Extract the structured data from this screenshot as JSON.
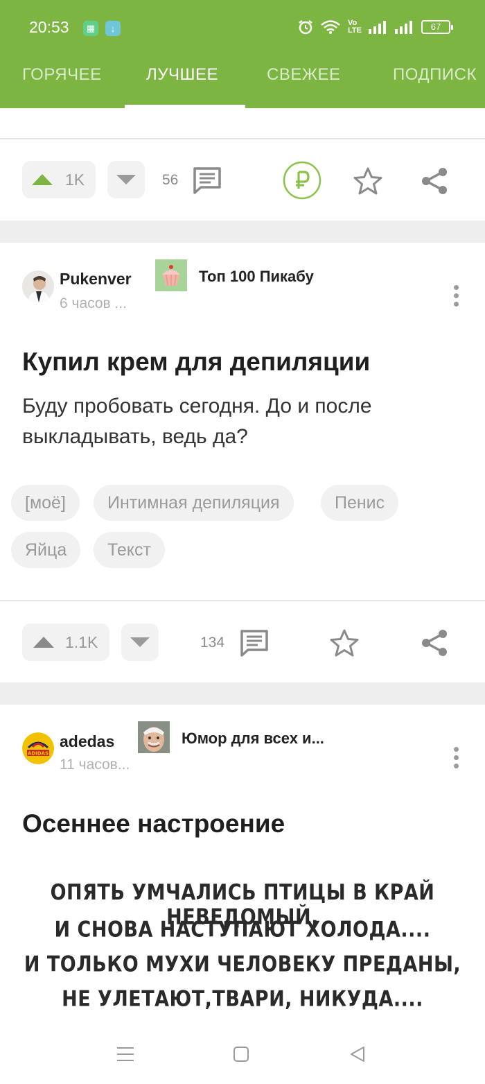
{
  "status_bar": {
    "time": "20:53",
    "battery": "67"
  },
  "tabs": [
    {
      "label": "ГОРЯЧЕЕ"
    },
    {
      "label": "ЛУЧШЕЕ"
    },
    {
      "label": "СВЕЖЕЕ"
    },
    {
      "label": "ПОДПИСК"
    }
  ],
  "prev_post": {
    "upvotes": "1K",
    "comments": "56"
  },
  "post1": {
    "author": "Pukenver",
    "time_ago": "6 часов ...",
    "community": "Топ 100 Пикабу",
    "title": "Купил крем для депиляции",
    "text": "Буду пробовать сегодня. До и после выкладывать, ведь да?",
    "tags": [
      "[моё]",
      "Интимная депиляция",
      "Пенис",
      "Яйца",
      "Текст"
    ],
    "upvotes": "1.1K",
    "comments": "134"
  },
  "post2": {
    "author": "adedas",
    "time_ago": "11 часов...",
    "community": "Юмор для всех и...",
    "title": "Осеннее настроение",
    "image_lines": [
      "ОПЯТЬ УМЧАЛИСЬ ПТИЦЫ В КРАЙ НЕВЕДОМЫЙ,",
      "И СНОВА НАСТУПАЮТ ХОЛОДА....",
      "И ТОЛЬКО МУХИ ЧЕЛОВЕКУ ПРЕДАНЫ,",
      "НЕ УЛЕТАЮТ,ТВАРИ, НИКУДА...."
    ]
  },
  "colors": {
    "brand_green": "#7db543",
    "donate_green": "#8bc34a"
  }
}
